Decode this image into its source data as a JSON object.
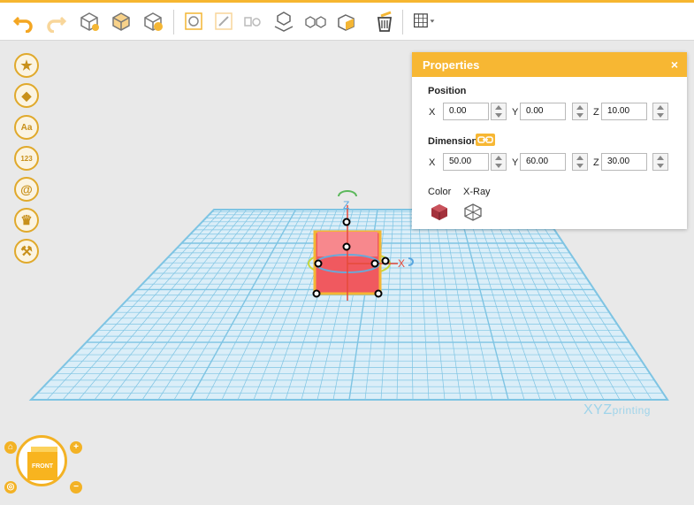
{
  "toolbar": {
    "items": [
      "undo-icon",
      "redo-icon",
      "add-object-icon",
      "group-objects-icon",
      "merge-objects-icon",
      "align-icon",
      "ungroup-icon",
      "duplicate-icon",
      "place-on-bed-icon",
      "mirror-icon",
      "paint-icon",
      "delete-icon",
      "grid-view-icon"
    ]
  },
  "sidebar": {
    "items": [
      {
        "name": "favorites",
        "glyph": "★"
      },
      {
        "name": "shapes",
        "glyph": "◆"
      },
      {
        "name": "text",
        "glyph": "Aa"
      },
      {
        "name": "numbers",
        "glyph": "123"
      },
      {
        "name": "symbols",
        "glyph": "@"
      },
      {
        "name": "crown",
        "glyph": "♛"
      },
      {
        "name": "tools",
        "glyph": "⚒"
      }
    ]
  },
  "properties": {
    "title": "Properties",
    "close": "×",
    "position_label": "Position",
    "dimension_label": "Dimension",
    "position": {
      "x": "0.00",
      "y": "0.00",
      "z": "10.00"
    },
    "dimension": {
      "x": "50.00",
      "y": "60.00",
      "z": "30.00"
    },
    "axis_x": "X",
    "axis_y": "Y",
    "axis_z": "Z",
    "color_label": "Color",
    "xray_label": "X-Ray"
  },
  "viewport": {
    "z_axis_label": "Z",
    "x_axis_label": "X",
    "brand": "XYZ",
    "brand_suffix": "printing"
  },
  "nav": {
    "cube_label": "FRONT",
    "zoom_in": "+",
    "zoom_out": "−"
  },
  "colors": {
    "accent": "#f7b733",
    "grid": "#7ec4e3",
    "object": "#f0595f"
  }
}
